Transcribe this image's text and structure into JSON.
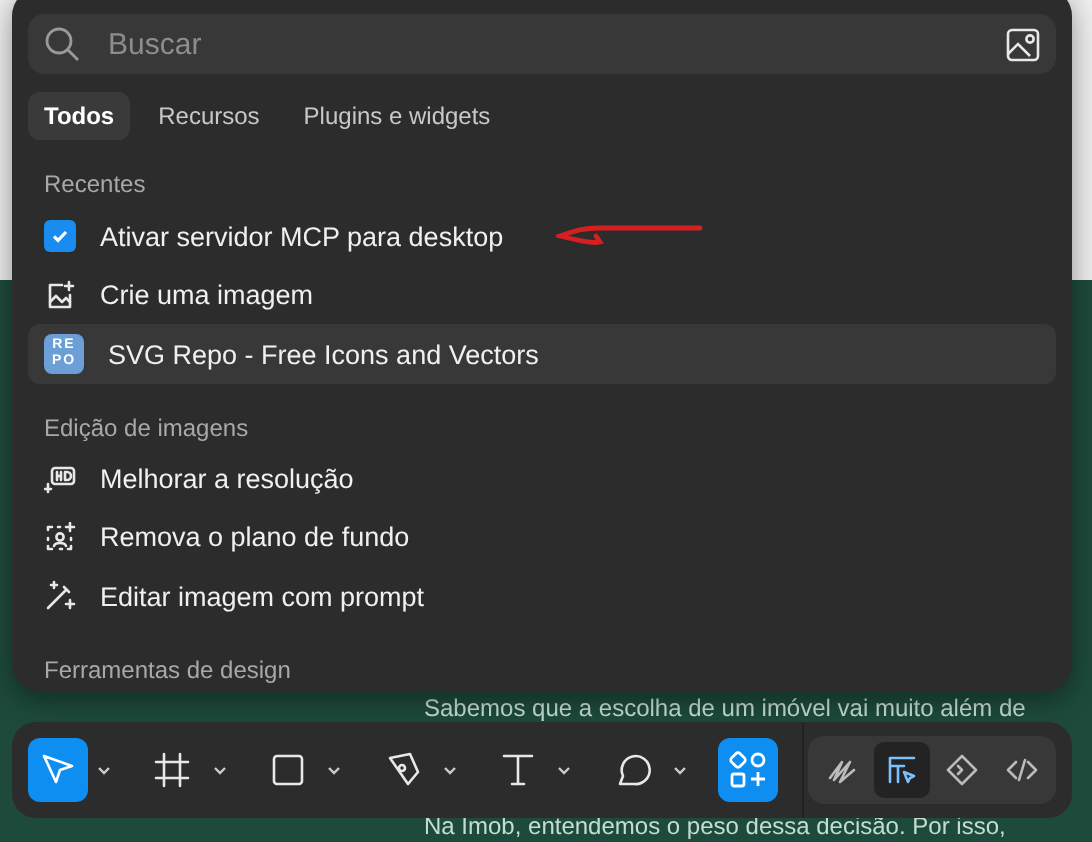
{
  "page_text": [
    "Sabemos que a escolha de um imóvel vai muito além de",
    "Na Imob, entendemos o peso dessa decisão. Por isso,"
  ],
  "search": {
    "placeholder": "Buscar"
  },
  "tabs": [
    {
      "label": "Todos",
      "selected": true
    },
    {
      "label": "Recursos",
      "selected": false
    },
    {
      "label": "Plugins e widgets",
      "selected": false
    }
  ],
  "sections": [
    {
      "title": "Recentes",
      "items": [
        {
          "kind": "checkbox",
          "label": "Ativar servidor MCP para desktop",
          "checked": true,
          "selected": false
        },
        {
          "kind": "image-spark",
          "label": "Crie uma imagem",
          "selected": false
        },
        {
          "kind": "repo",
          "label": "SVG Repo - Free Icons and Vectors",
          "logo_top": "RE",
          "logo_bottom": "PO",
          "selected": true
        }
      ]
    },
    {
      "title": "Edição de imagens",
      "items": [
        {
          "kind": "hd",
          "label": "Melhorar a resolução",
          "selected": false
        },
        {
          "kind": "remove-bg",
          "label": "Remova o plano de fundo",
          "selected": false
        },
        {
          "kind": "wand",
          "label": "Editar imagem com prompt",
          "selected": false
        }
      ]
    },
    {
      "title": "Ferramentas de design"
    }
  ],
  "toolbar": {
    "tools": [
      {
        "kind": "move",
        "selected": true
      },
      {
        "kind": "frame",
        "selected": false
      },
      {
        "kind": "rectangle",
        "selected": false
      },
      {
        "kind": "pen",
        "selected": false
      },
      {
        "kind": "text",
        "selected": false
      },
      {
        "kind": "comment",
        "selected": false
      }
    ],
    "actions": {
      "selected": true
    },
    "modes": [
      {
        "kind": "draw",
        "selected": false
      },
      {
        "kind": "design",
        "selected": true
      },
      {
        "kind": "prototype",
        "selected": false
      },
      {
        "kind": "dev",
        "selected": false
      }
    ]
  }
}
